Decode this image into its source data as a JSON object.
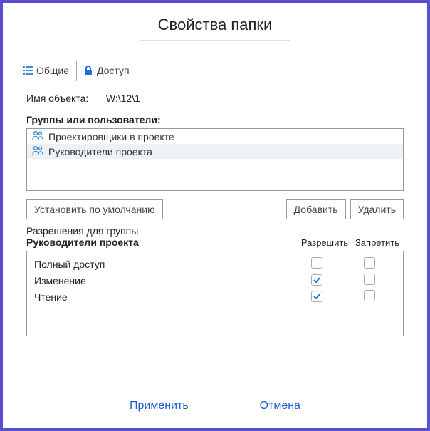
{
  "title": "Свойства папки",
  "tabs": {
    "general": "Общие",
    "access": "Доступ"
  },
  "objectName": {
    "label": "Имя объекта:",
    "value": "W:\\12\\1"
  },
  "groupsLabel": "Группы или пользователи:",
  "groups": [
    {
      "label": "Проектировщики в проекте",
      "selected": false
    },
    {
      "label": "Руководители проекта",
      "selected": true
    }
  ],
  "buttons": {
    "defaults": "Установить по умолчанию",
    "add": "Добавить",
    "remove": "Удалить"
  },
  "permLabel": "Разрешения для группы",
  "selectedGroupName": "Руководители проекта",
  "columns": {
    "allow": "Разрешить",
    "deny": "Запретить"
  },
  "permissions": [
    {
      "name": "Полный доступ",
      "allow": false,
      "deny": false
    },
    {
      "name": "Изменение",
      "allow": true,
      "deny": false
    },
    {
      "name": "Чтение",
      "allow": true,
      "deny": false
    }
  ],
  "footer": {
    "apply": "Применить",
    "cancel": "Отмена"
  }
}
